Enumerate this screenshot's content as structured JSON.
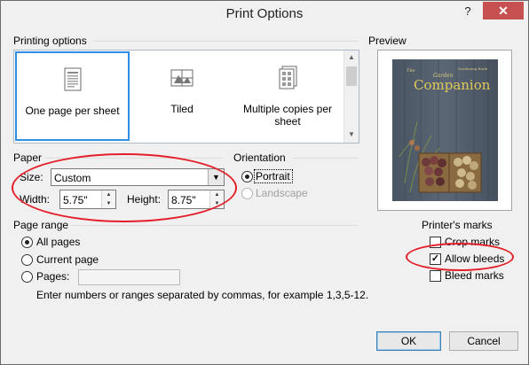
{
  "window": {
    "title": "Print Options",
    "help_label": "?",
    "close_label": "✕"
  },
  "printing_options": {
    "label": "Printing options",
    "tiles": [
      {
        "label": "One page per sheet",
        "selected": true,
        "icon": "single-page-icon"
      },
      {
        "label": "Tiled",
        "selected": false,
        "icon": "tiled-page-icon"
      },
      {
        "label": "Multiple copies per sheet",
        "selected": false,
        "icon": "multiple-copies-icon"
      }
    ]
  },
  "preview": {
    "label": "Preview",
    "cover_title": "Companion",
    "cover_small_left": "The",
    "cover_small_right": "Gardening Book",
    "cover_script": "Garden"
  },
  "paper": {
    "label": "Paper",
    "size_label": "Size:",
    "size_value": "Custom",
    "width_label": "Width:",
    "width_value": "5.75\"",
    "height_label": "Height:",
    "height_value": "8.75\""
  },
  "orientation": {
    "label": "Orientation",
    "portrait_label": "Portrait",
    "landscape_label": "Landscape",
    "selected": "Portrait"
  },
  "page_range": {
    "label": "Page range",
    "all_pages_label": "All pages",
    "current_page_label": "Current page",
    "pages_label": "Pages:",
    "pages_value": "",
    "selected": "All pages",
    "hint": "Enter numbers or ranges separated by commas, for example 1,3,5-12."
  },
  "printers_marks": {
    "label": "Printer's marks",
    "crop_marks_label": "Crop marks",
    "crop_marks_checked": false,
    "allow_bleeds_label": "Allow bleeds",
    "allow_bleeds_checked": true,
    "bleed_marks_label": "Bleed marks",
    "bleed_marks_checked": false
  },
  "buttons": {
    "ok_label": "OK",
    "cancel_label": "Cancel"
  },
  "colors": {
    "accent": "#2f8ee5",
    "annotation": "#e3202a",
    "close": "#c75050"
  }
}
